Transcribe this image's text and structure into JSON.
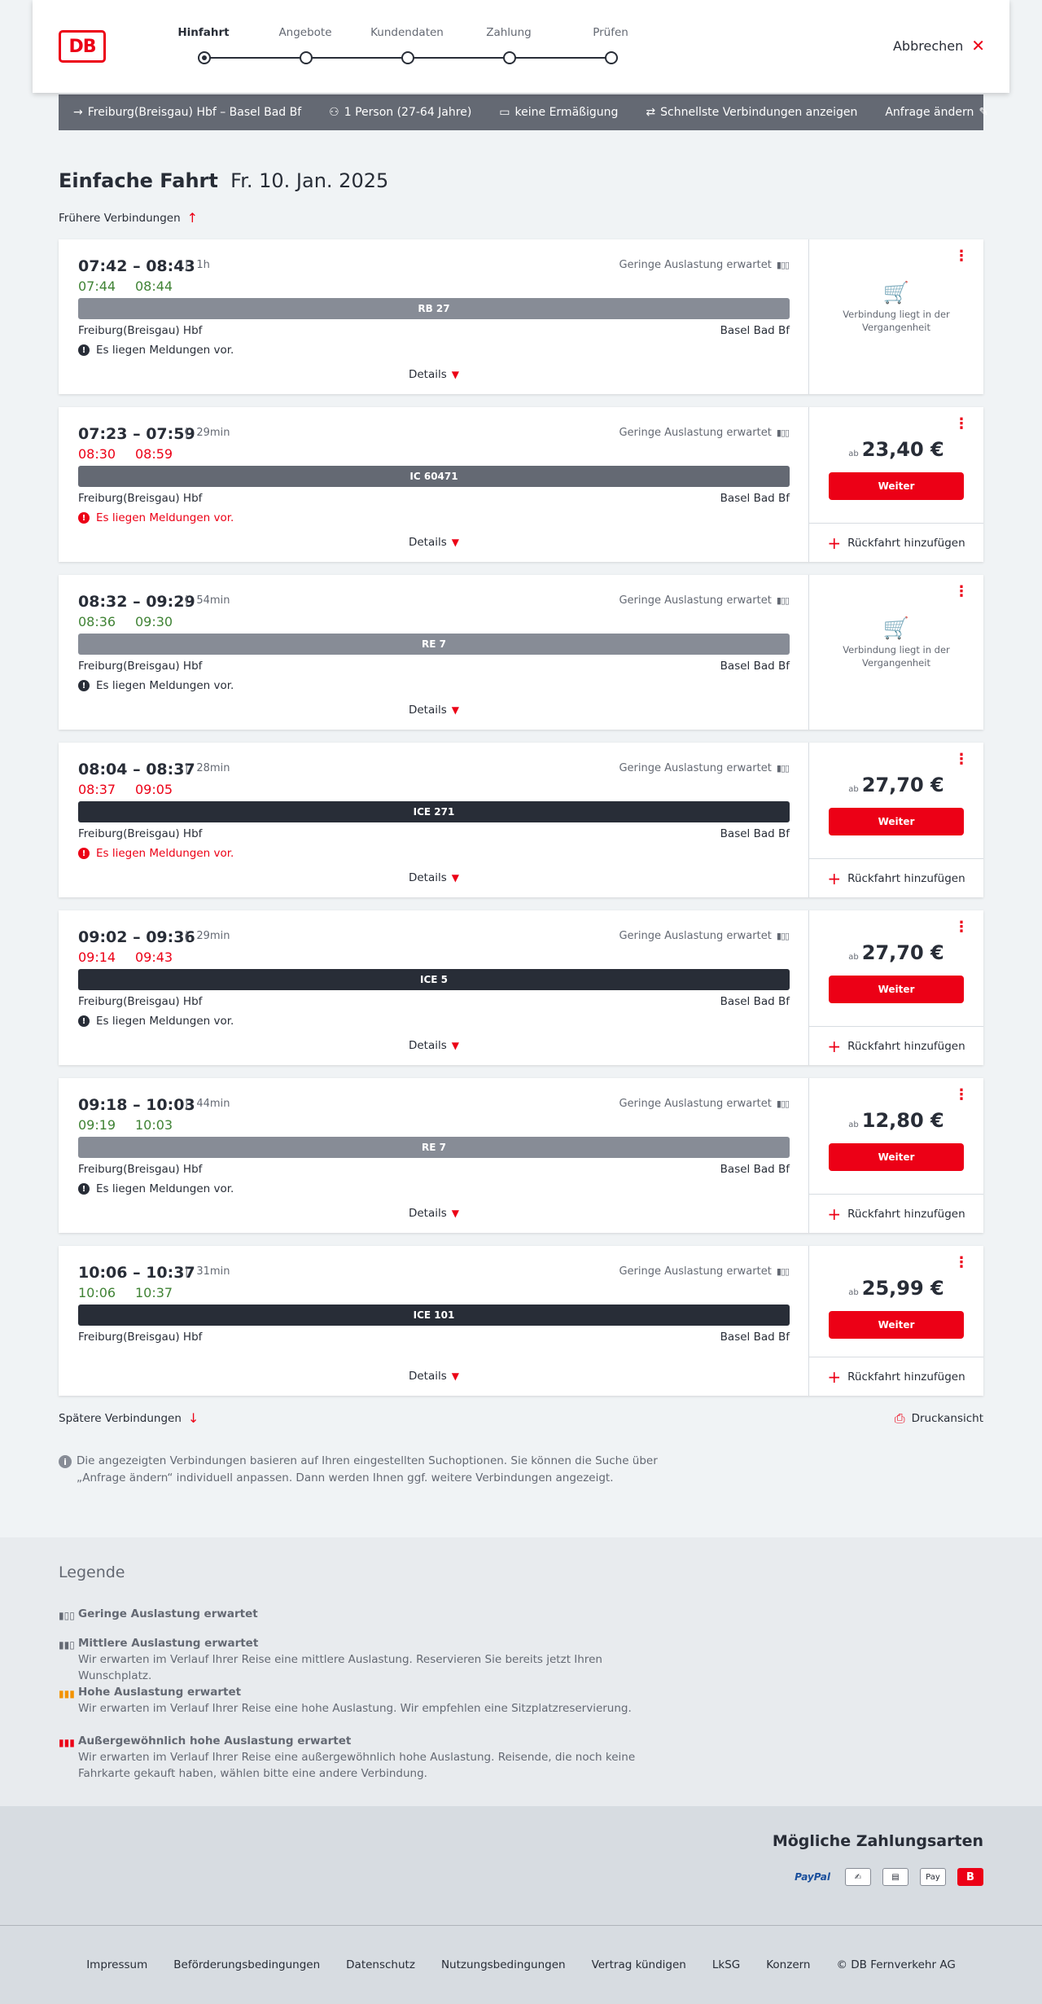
{
  "header": {
    "logo": "DB",
    "steps": [
      "Hinfahrt",
      "Angebote",
      "Kundendaten",
      "Zahlung",
      "Prüfen"
    ],
    "active_step": "Hinfahrt",
    "cancel_label": "Abbrechen"
  },
  "search": {
    "route": "Freiburg(Breisgau) Hbf – Basel Bad Bf",
    "passengers": "1 Person (27-64 Jahre)",
    "discount": "keine Ermäßigung",
    "option": "Schnellste Verbindungen anzeigen",
    "change_label": "Anfrage ändern"
  },
  "page": {
    "title": "Einfache Fahrt",
    "date": "Fr. 10. Jan. 2025",
    "earlier_label": "Frühere Verbindungen",
    "later_label": "Spätere Verbindungen",
    "print_label": "Druckansicht",
    "info_text": "Die angezeigten Verbindungen basieren auf Ihren eingestellten Suchoptionen. Sie können die Suche über „Anfrage ändern“ individuell anpassen. Dann werden Ihnen ggf. weitere Verbindungen angezeigt."
  },
  "labels": {
    "occupancy": "Geringe Auslastung erwartet",
    "details": "Details",
    "weiter": "Weiter",
    "ab": "ab",
    "return": "Rückfahrt hinzufügen",
    "past": "Verbindung liegt in der Vergangenheit",
    "message": "Es liegen Meldungen vor."
  },
  "connections": [
    {
      "times": "07:42 – 08:43",
      "duration": "1h",
      "rt_dep": "07:44",
      "rt_arr": "08:44",
      "rt_dep_color": "green",
      "rt_arr_color": "green",
      "train": "RB 27",
      "train_style": "gray",
      "from": "Freiburg(Breisgau) Hbf",
      "to": "Basel Bad Bf",
      "message": "Es liegen Meldungen vor.",
      "message_warn": false,
      "past": true,
      "price": ""
    },
    {
      "times": "07:23 – 07:59",
      "duration": "29min",
      "rt_dep": "08:30",
      "rt_arr": "08:59",
      "rt_dep_color": "red",
      "rt_arr_color": "red",
      "train": "IC 60471",
      "train_style": "mid",
      "from": "Freiburg(Breisgau) Hbf",
      "to": "Basel Bad Bf",
      "message": "Es liegen Meldungen vor.",
      "message_warn": true,
      "past": false,
      "price": "23,40 €"
    },
    {
      "times": "08:32 – 09:29",
      "duration": "54min",
      "rt_dep": "08:36",
      "rt_arr": "09:30",
      "rt_dep_color": "green",
      "rt_arr_color": "green",
      "train": "RE 7",
      "train_style": "gray",
      "from": "Freiburg(Breisgau) Hbf",
      "to": "Basel Bad Bf",
      "message": "Es liegen Meldungen vor.",
      "message_warn": false,
      "past": true,
      "price": ""
    },
    {
      "times": "08:04 – 08:37",
      "duration": "28min",
      "rt_dep": "08:37",
      "rt_arr": "09:05",
      "rt_dep_color": "red",
      "rt_arr_color": "red",
      "train": "ICE 271",
      "train_style": "dark",
      "from": "Freiburg(Breisgau) Hbf",
      "to": "Basel Bad Bf",
      "message": "Es liegen Meldungen vor.",
      "message_warn": true,
      "past": false,
      "price": "27,70 €"
    },
    {
      "times": "09:02 – 09:36",
      "duration": "29min",
      "rt_dep": "09:14",
      "rt_arr": "09:43",
      "rt_dep_color": "red",
      "rt_arr_color": "red",
      "train": "ICE 5",
      "train_style": "dark",
      "from": "Freiburg(Breisgau) Hbf",
      "to": "Basel Bad Bf",
      "message": "Es liegen Meldungen vor.",
      "message_warn": false,
      "past": false,
      "price": "27,70 €"
    },
    {
      "times": "09:18 – 10:03",
      "duration": "44min",
      "rt_dep": "09:19",
      "rt_arr": "10:03",
      "rt_dep_color": "green",
      "rt_arr_color": "green",
      "train": "RE 7",
      "train_style": "gray",
      "from": "Freiburg(Breisgau) Hbf",
      "to": "Basel Bad Bf",
      "message": "Es liegen Meldungen vor.",
      "message_warn": false,
      "past": false,
      "price": "12,80 €"
    },
    {
      "times": "10:06 – 10:37",
      "duration": "31min",
      "rt_dep": "10:06",
      "rt_arr": "10:37",
      "rt_dep_color": "green",
      "rt_arr_color": "green",
      "train": "ICE 101",
      "train_style": "dark",
      "from": "Freiburg(Breisgau) Hbf",
      "to": "Basel Bad Bf",
      "message": "",
      "message_warn": false,
      "past": false,
      "price": "25,99 €"
    }
  ],
  "legend": {
    "title": "Legende",
    "items": [
      {
        "title": "Geringe Auslastung erwartet",
        "desc": "",
        "color": "#646973"
      },
      {
        "title": "Mittlere Auslastung erwartet",
        "desc": "Wir erwarten im Verlauf Ihrer Reise eine mittlere Auslastung. Reservieren Sie bereits jetzt Ihren Wunschplatz.",
        "color": "#646973"
      },
      {
        "title": "Hohe Auslastung erwartet",
        "desc": "Wir erwarten im Verlauf Ihrer Reise eine hohe Auslastung. Wir empfehlen eine Sitzplatzreservierung.",
        "color": "#f39200"
      },
      {
        "title": "Außergewöhnlich hohe Auslastung erwartet",
        "desc": "Wir erwarten im Verlauf Ihrer Reise eine außergewöhnlich hohe Auslastung. Reisende, die noch keine Fahrkarte gekauft haben, wählen bitte eine andere Verbindung.",
        "color": "#ec0016"
      }
    ]
  },
  "payment": {
    "title": "Mögliche Zahlungsarten",
    "methods": [
      "PayPal",
      "Kreditkarte",
      "SEPA",
      "Apple Pay",
      "DB"
    ]
  },
  "footer": {
    "links": [
      "Impressum",
      "Beförderungsbedingungen",
      "Datenschutz",
      "Nutzungsbedingungen",
      "Vertrag kündigen",
      "LkSG",
      "Konzern",
      "© DB Fernverkehr AG"
    ]
  }
}
